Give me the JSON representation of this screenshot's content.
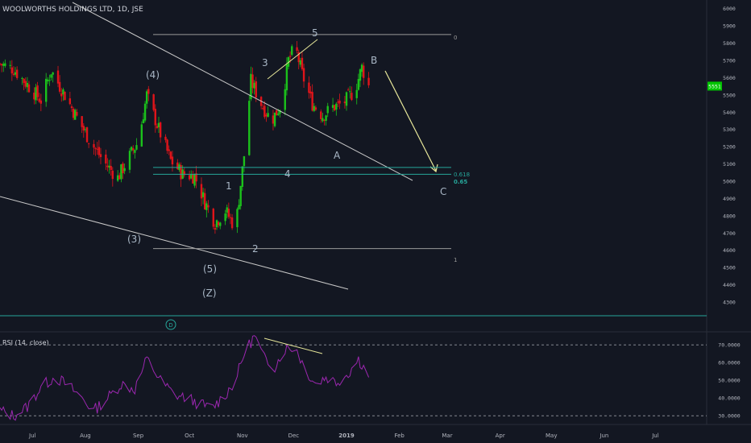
{
  "header": {
    "symbol_title": "WOOLWORTHS HOLDINGS LTD, 1D, JSE"
  },
  "colors": {
    "background": "#131722",
    "up_candle": "#1bc11b",
    "down_candle": "#e0141a",
    "wave_label": "#a9b7c6",
    "trend_line": "#c8c8c8",
    "fib_line": "#26a69a",
    "wedge_line": "#e8e89a",
    "rsi_line": "#9c27b0",
    "price_tag": "#00c400"
  },
  "price_axis": {
    "ticks": [
      "6000",
      "5900",
      "5800",
      "5700",
      "5600",
      "5500",
      "5400",
      "5300",
      "5200",
      "5100",
      "5000",
      "4900",
      "4800",
      "4700",
      "4600",
      "4500",
      "4400",
      "4300"
    ],
    "last_price_label": "5551",
    "last_price": 5551
  },
  "time_axis": {
    "ticks": [
      "Jul",
      "Aug",
      "Sep",
      "Oct",
      "Nov",
      "Dec",
      "2019",
      "Feb",
      "Mar",
      "Apr",
      "May",
      "Jun",
      "Jul"
    ]
  },
  "wave_labels": {
    "w_4p": "(4)",
    "w_3p": "(3)",
    "w_5p": "(5)",
    "w_z": "(Z)",
    "w1": "1",
    "w2": "2",
    "w3": "3",
    "w4": "4",
    "w5": "5",
    "wA": "A",
    "wB": "B",
    "wC": "C"
  },
  "fib_levels": {
    "level_0": "0",
    "level_618": "0.618",
    "level_65": "0.65",
    "level_1": "1"
  },
  "dividend_marker": "D",
  "rsi": {
    "label": "RSI (14, close)",
    "ticks": [
      "70.0000",
      "60.0000",
      "50.0000",
      "40.0000",
      "30.0000"
    ]
  },
  "chart_data": {
    "type": "candlestick",
    "title": "WOOLWORTHS HOLDINGS LTD, 1D, JSE",
    "x_range": [
      "2018-06-12",
      "2019-07-31"
    ],
    "ylim": [
      4230,
      6050
    ],
    "levels": {
      "fib_0": 5850,
      "fib_0618": 5080,
      "fib_065": 5040,
      "fib_1": 4610
    },
    "price_path": [
      {
        "date": "2018-06-12",
        "price": 5680
      },
      {
        "date": "2018-06-20",
        "price": 5650
      },
      {
        "date": "2018-06-28",
        "price": 5560
      },
      {
        "date": "2018-07-06",
        "price": 5470
      },
      {
        "date": "2018-07-12",
        "price": 5640
      },
      {
        "date": "2018-07-20",
        "price": 5500
      },
      {
        "date": "2018-07-28",
        "price": 5350
      },
      {
        "date": "2018-08-04",
        "price": 5230
      },
      {
        "date": "2018-08-12",
        "price": 5110
      },
      {
        "date": "2018-08-20",
        "price": 5020
      },
      {
        "date": "2018-08-26",
        "price": 5130
      },
      {
        "date": "2018-09-01",
        "price": 5230
      },
      {
        "date": "2018-09-06",
        "price": 5500
      },
      {
        "date": "2018-09-13",
        "price": 5300
      },
      {
        "date": "2018-09-20",
        "price": 5120
      },
      {
        "date": "2018-09-27",
        "price": 5040
      },
      {
        "date": "2018-10-04",
        "price": 5030
      },
      {
        "date": "2018-10-10",
        "price": 4880
      },
      {
        "date": "2018-10-16",
        "price": 4760
      },
      {
        "date": "2018-10-22",
        "price": 4830
      },
      {
        "date": "2018-10-28",
        "price": 4730
      },
      {
        "date": "2018-11-02",
        "price": 5150
      },
      {
        "date": "2018-11-06",
        "price": 5580
      },
      {
        "date": "2018-11-12",
        "price": 5450
      },
      {
        "date": "2018-11-18",
        "price": 5350
      },
      {
        "date": "2018-11-24",
        "price": 5450
      },
      {
        "date": "2018-11-28",
        "price": 5700
      },
      {
        "date": "2018-12-02",
        "price": 5780
      },
      {
        "date": "2018-12-06",
        "price": 5620
      },
      {
        "date": "2018-12-12",
        "price": 5450
      },
      {
        "date": "2018-12-18",
        "price": 5380
      },
      {
        "date": "2018-12-24",
        "price": 5430
      },
      {
        "date": "2018-12-30",
        "price": 5450
      },
      {
        "date": "2019-01-06",
        "price": 5530
      },
      {
        "date": "2019-01-10",
        "price": 5660
      },
      {
        "date": "2019-01-14",
        "price": 5551
      }
    ],
    "rsi_path": [
      {
        "date": "2018-06-12",
        "value": 33
      },
      {
        "date": "2018-06-20",
        "value": 30
      },
      {
        "date": "2018-06-28",
        "value": 35
      },
      {
        "date": "2018-07-06",
        "value": 46
      },
      {
        "date": "2018-07-14",
        "value": 52
      },
      {
        "date": "2018-07-22",
        "value": 47
      },
      {
        "date": "2018-07-30",
        "value": 40
      },
      {
        "date": "2018-08-06",
        "value": 33
      },
      {
        "date": "2018-08-14",
        "value": 40
      },
      {
        "date": "2018-08-22",
        "value": 48
      },
      {
        "date": "2018-08-30",
        "value": 45
      },
      {
        "date": "2018-09-06",
        "value": 62
      },
      {
        "date": "2018-09-14",
        "value": 50
      },
      {
        "date": "2018-09-22",
        "value": 42
      },
      {
        "date": "2018-09-30",
        "value": 40
      },
      {
        "date": "2018-10-06",
        "value": 37
      },
      {
        "date": "2018-10-14",
        "value": 34
      },
      {
        "date": "2018-10-22",
        "value": 42
      },
      {
        "date": "2018-10-28",
        "value": 50
      },
      {
        "date": "2018-11-02",
        "value": 65
      },
      {
        "date": "2018-11-08",
        "value": 75
      },
      {
        "date": "2018-11-14",
        "value": 62
      },
      {
        "date": "2018-11-20",
        "value": 58
      },
      {
        "date": "2018-11-26",
        "value": 68
      },
      {
        "date": "2018-12-02",
        "value": 69
      },
      {
        "date": "2018-12-08",
        "value": 56
      },
      {
        "date": "2018-12-14",
        "value": 48
      },
      {
        "date": "2018-12-20",
        "value": 52
      },
      {
        "date": "2018-12-26",
        "value": 49
      },
      {
        "date": "2019-01-02",
        "value": 54
      },
      {
        "date": "2019-01-08",
        "value": 62
      },
      {
        "date": "2019-01-14",
        "value": 53
      }
    ],
    "rsi_ylim": [
      26,
      76
    ],
    "rsi_levels": [
      70,
      30
    ]
  }
}
